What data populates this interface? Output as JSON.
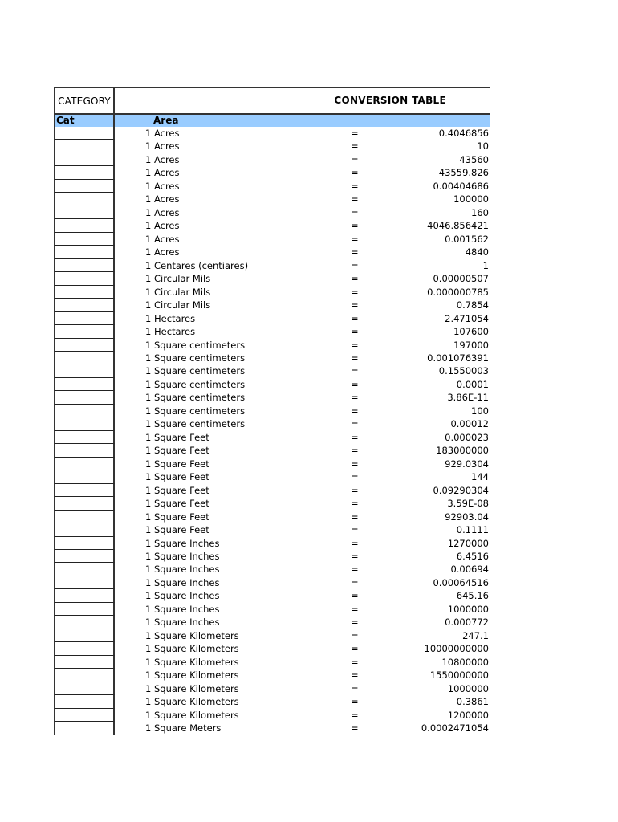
{
  "header": {
    "category_label": "CATEGORY",
    "title": "CONVERSION TABLE"
  },
  "band": {
    "cat_label": "Cat",
    "area_label": "Area",
    "color": "#99ccff"
  },
  "rows": [
    {
      "unit": "1 Acres",
      "eq": "=",
      "value": "0.4046856"
    },
    {
      "unit": "1 Acres",
      "eq": "=",
      "value": "10"
    },
    {
      "unit": "1 Acres",
      "eq": "=",
      "value": "43560"
    },
    {
      "unit": "1 Acres",
      "eq": "=",
      "value": "43559.826"
    },
    {
      "unit": "1 Acres",
      "eq": "=",
      "value": "0.00404686"
    },
    {
      "unit": "1 Acres",
      "eq": "=",
      "value": "100000"
    },
    {
      "unit": "1 Acres",
      "eq": "=",
      "value": "160"
    },
    {
      "unit": "1 Acres",
      "eq": "=",
      "value": "4046.856421"
    },
    {
      "unit": "1 Acres",
      "eq": "=",
      "value": "0.001562"
    },
    {
      "unit": "1 Acres",
      "eq": "=",
      "value": "4840"
    },
    {
      "unit": "1 Centares (centiares)",
      "eq": "=",
      "value": "1"
    },
    {
      "unit": "1 Circular Mils",
      "eq": "=",
      "value": "0.00000507"
    },
    {
      "unit": "1 Circular Mils",
      "eq": "=",
      "value": "0.000000785"
    },
    {
      "unit": "1 Circular Mils",
      "eq": "=",
      "value": "0.7854"
    },
    {
      "unit": "1 Hectares",
      "eq": "=",
      "value": "2.471054"
    },
    {
      "unit": "1 Hectares",
      "eq": "=",
      "value": "107600"
    },
    {
      "unit": "1 Square centimeters",
      "eq": "=",
      "value": "197000"
    },
    {
      "unit": "1 Square centimeters",
      "eq": "=",
      "value": "0.001076391"
    },
    {
      "unit": "1 Square centimeters",
      "eq": "=",
      "value": "0.1550003"
    },
    {
      "unit": "1 Square centimeters",
      "eq": "=",
      "value": "0.0001"
    },
    {
      "unit": "1 Square centimeters",
      "eq": "=",
      "value": "3.86E-11"
    },
    {
      "unit": "1 Square centimeters",
      "eq": "=",
      "value": "100"
    },
    {
      "unit": "1 Square centimeters",
      "eq": "=",
      "value": "0.00012"
    },
    {
      "unit": "1 Square Feet",
      "eq": "=",
      "value": "0.000023"
    },
    {
      "unit": "1 Square Feet",
      "eq": "=",
      "value": "183000000"
    },
    {
      "unit": "1 Square Feet",
      "eq": "=",
      "value": "929.0304"
    },
    {
      "unit": "1 Square Feet",
      "eq": "=",
      "value": "144"
    },
    {
      "unit": "1 Square Feet",
      "eq": "=",
      "value": "0.09290304"
    },
    {
      "unit": "1 Square Feet",
      "eq": "=",
      "value": "3.59E-08"
    },
    {
      "unit": "1 Square Feet",
      "eq": "=",
      "value": "92903.04"
    },
    {
      "unit": "1 Square Feet",
      "eq": "=",
      "value": "0.1111"
    },
    {
      "unit": "1 Square Inches",
      "eq": "=",
      "value": "1270000"
    },
    {
      "unit": "1 Square Inches",
      "eq": "=",
      "value": "6.4516"
    },
    {
      "unit": "1 Square Inches",
      "eq": "=",
      "value": "0.00694"
    },
    {
      "unit": "1 Square Inches",
      "eq": "=",
      "value": "0.00064516"
    },
    {
      "unit": "1 Square Inches",
      "eq": "=",
      "value": "645.16"
    },
    {
      "unit": "1 Square Inches",
      "eq": "=",
      "value": "1000000"
    },
    {
      "unit": "1 Square Inches",
      "eq": "=",
      "value": "0.000772"
    },
    {
      "unit": "1 Square Kilometers",
      "eq": "=",
      "value": "247.1"
    },
    {
      "unit": "1 Square Kilometers",
      "eq": "=",
      "value": "10000000000"
    },
    {
      "unit": "1 Square Kilometers",
      "eq": "=",
      "value": "10800000"
    },
    {
      "unit": "1 Square Kilometers",
      "eq": "=",
      "value": "1550000000"
    },
    {
      "unit": "1 Square Kilometers",
      "eq": "=",
      "value": "1000000"
    },
    {
      "unit": "1 Square Kilometers",
      "eq": "=",
      "value": "0.3861"
    },
    {
      "unit": "1 Square Kilometers",
      "eq": "=",
      "value": "1200000"
    },
    {
      "unit": "1 Square Meters",
      "eq": "=",
      "value": "0.0002471054"
    }
  ]
}
